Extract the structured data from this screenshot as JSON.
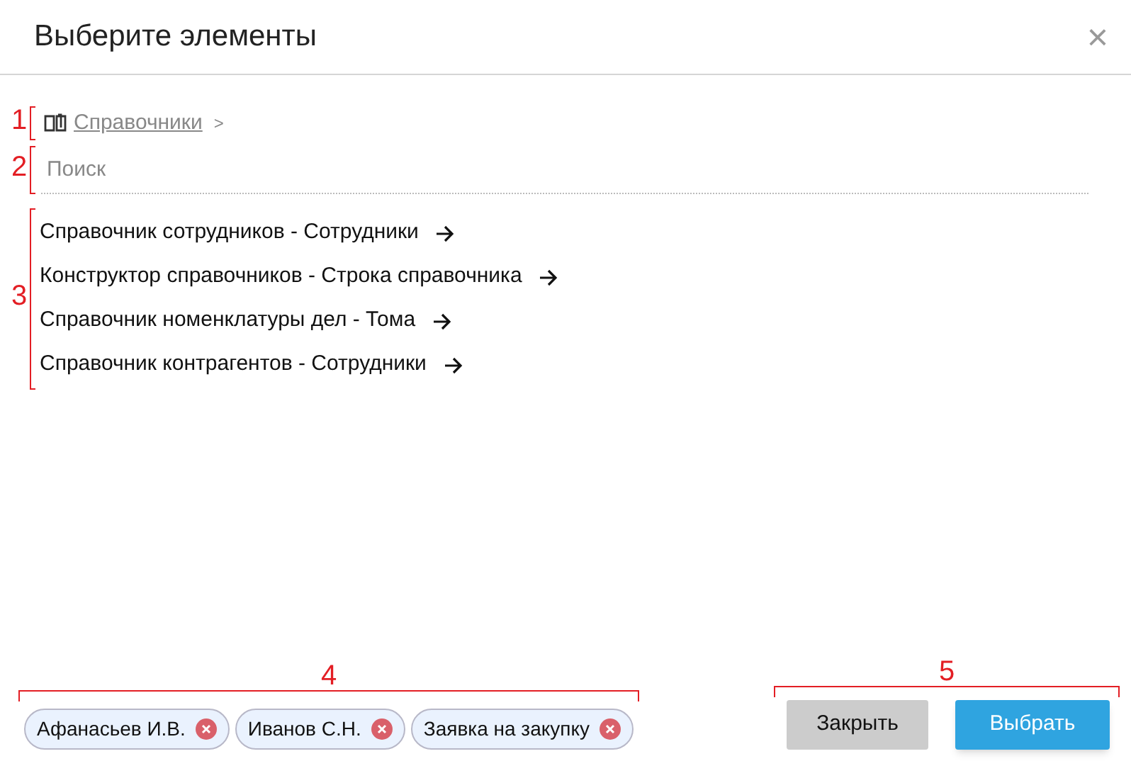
{
  "window": {
    "title": "Выберите элементы",
    "close": "×"
  },
  "breadcrumb": {
    "link": "Справочники",
    "separator": ">"
  },
  "search": {
    "placeholder": "Поиск"
  },
  "items": [
    {
      "label": "Справочник сотрудников - Сотрудники"
    },
    {
      "label": "Конструктор справочников - Строка справочника"
    },
    {
      "label": "Справочник номенклатуры дел - Тома"
    },
    {
      "label": "Справочник контрагентов - Сотрудники"
    }
  ],
  "chips": [
    {
      "label": "Афанасьев И.В."
    },
    {
      "label": "Иванов С.Н."
    },
    {
      "label": "Заявка на закупку"
    }
  ],
  "buttons": [
    {
      "label": "Закрыть",
      "kind": "secondary"
    },
    {
      "label": "Выбрать",
      "kind": "primary"
    }
  ],
  "annotations": [
    "1",
    "2",
    "3",
    "4",
    "5"
  ]
}
